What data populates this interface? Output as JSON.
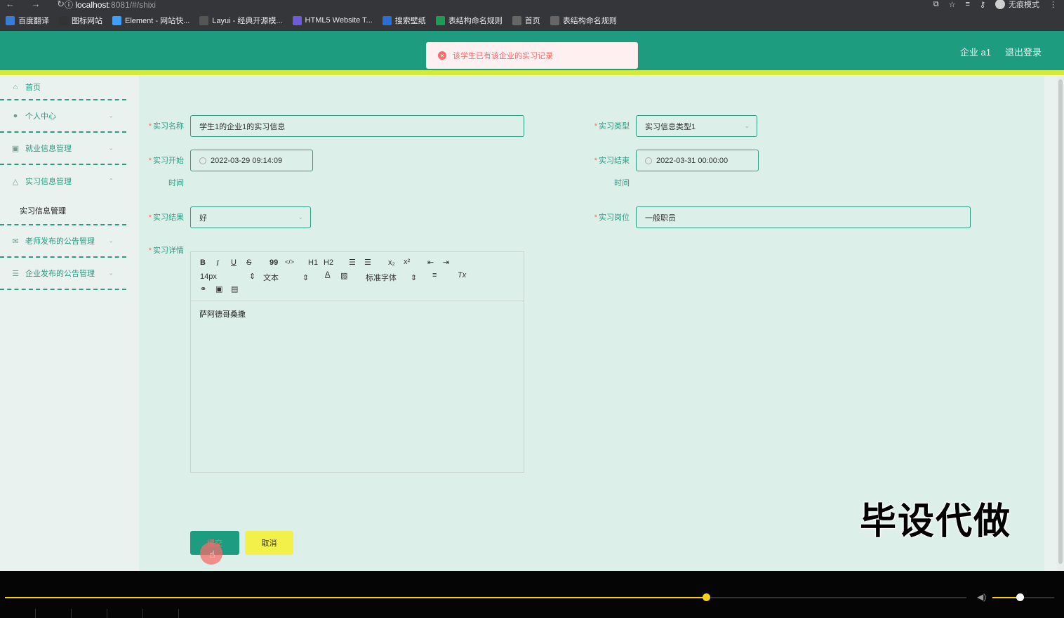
{
  "browser": {
    "url_host": "localhost",
    "url_rest": ":8081/#/shixi",
    "incognito_label": "无痕模式",
    "bookmarks": [
      {
        "label": "百度翻译",
        "color": "#3a7bd5"
      },
      {
        "label": "图标网站",
        "color": "#333333"
      },
      {
        "label": "Element - 网站快...",
        "color": "#409eff"
      },
      {
        "label": "Layui - 经典开源模...",
        "color": "#555555"
      },
      {
        "label": "HTML5 Website T...",
        "color": "#6f5bd8"
      },
      {
        "label": "搜索壁纸",
        "color": "#2b6fd6"
      },
      {
        "label": "表结构命名规则",
        "color": "#1c9b56"
      },
      {
        "label": "首页",
        "color": "#666666"
      },
      {
        "label": "表结构命名规则",
        "color": "#666666"
      }
    ]
  },
  "header": {
    "user": "企业 a1",
    "logout": "退出登录",
    "accent": "#1e9c80",
    "stripe": "#d7ea3a"
  },
  "toast": {
    "message": "该学生已有该企业的实习记录",
    "color": "#f56c6c"
  },
  "sidebar": {
    "items": [
      {
        "label": "首页",
        "icon": "home-icon"
      },
      {
        "label": "个人中心",
        "icon": "user-icon"
      },
      {
        "label": "就业信息管理",
        "icon": "briefcase-icon"
      },
      {
        "label": "实习信息管理",
        "icon": "bell-icon"
      },
      {
        "label": "老师发布的公告管理",
        "icon": "mail-icon"
      },
      {
        "label": "企业发布的公告管理",
        "icon": "sliders-icon"
      }
    ],
    "submenu": {
      "label": "实习信息管理"
    }
  },
  "form": {
    "name_label": "实习名称",
    "name_value": "学生1的企业1的实习信息",
    "type_label": "实习类型",
    "type_value": "实习信息类型1",
    "start_label_1": "实习开始",
    "start_label_2": "时间",
    "start_value": "2022-03-29 09:14:09",
    "end_label_1": "实习结束",
    "end_label_2": "时间",
    "end_value": "2022-03-31 00:00:00",
    "result_label": "实习结果",
    "result_value": "好",
    "position_label": "实习岗位",
    "position_value": "一般职员",
    "detail_label": "实习详情",
    "required_mark": "*"
  },
  "editor": {
    "font_size": "14px",
    "block_format": "文本",
    "font_family": "标准字体",
    "content": "萨阿德哥桑撒",
    "toolbar": {
      "bold": "B",
      "italic": "I",
      "underline": "U",
      "strike": "S",
      "quote": "99",
      "code": "</>",
      "h1": "H1",
      "h2": "H2",
      "sub": "x₂",
      "sup": "x²",
      "clean": "Tx"
    }
  },
  "buttons": {
    "submit": "提交",
    "cancel": "取消"
  },
  "watermark": "毕设代做",
  "player": {
    "progress": 0.729,
    "volume": 0.44
  }
}
